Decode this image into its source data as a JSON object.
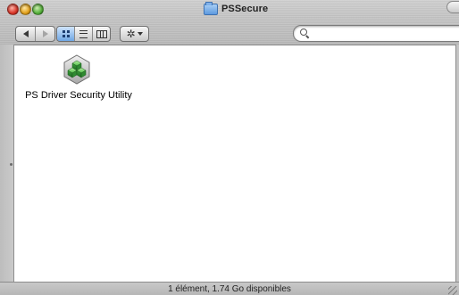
{
  "window": {
    "title": "PSSecure",
    "title_icon": "folder-icon"
  },
  "toolbar": {
    "back_icon": "back-arrow-icon",
    "forward_icon": "forward-arrow-icon",
    "view_modes": [
      {
        "name": "icon-view",
        "icon": "grid-icon",
        "active": true
      },
      {
        "name": "list-view",
        "icon": "list-icon",
        "active": false
      },
      {
        "name": "column-view",
        "icon": "columns-icon",
        "active": false
      }
    ],
    "action_icon": "gear-icon",
    "search": {
      "value": "",
      "placeholder": ""
    }
  },
  "files": [
    {
      "label": "PS Driver Security Utility",
      "icon": "green-cubes-app-icon"
    }
  ],
  "status": {
    "text": "1 élément, 1.74 Go disponibles"
  },
  "colors": {
    "active_view": "#6fa6e4",
    "app_icon_green": "#3fa34a"
  }
}
